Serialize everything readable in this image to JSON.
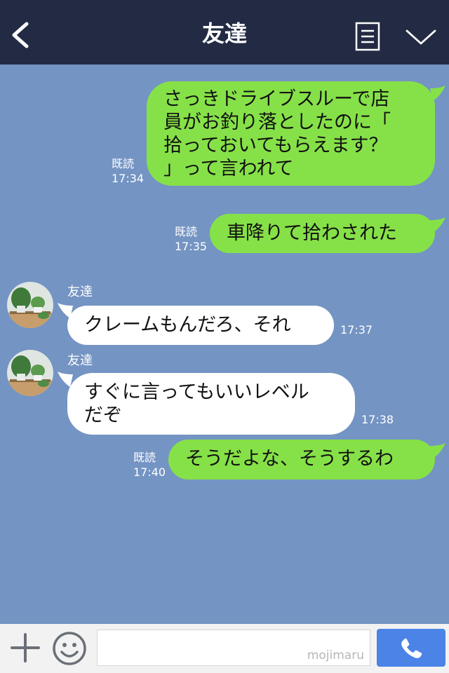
{
  "header": {
    "title": "友達"
  },
  "messages": [
    {
      "side": "out",
      "lines": [
        "さっきドライブスルーで店",
        "員がお釣り落としたのに「",
        "拾っておいてもらえます？",
        "」って言われて"
      ],
      "read": "既読",
      "time": "17:34"
    },
    {
      "side": "out",
      "lines": [
        "車降りて拾わされた"
      ],
      "read": "既読",
      "time": "17:35"
    },
    {
      "side": "in",
      "sender": "友達",
      "lines": [
        "クレームもんだろ、それ"
      ],
      "time": "17:37"
    },
    {
      "side": "in",
      "sender": "友達",
      "lines": [
        "すぐに言ってもいいレベル",
        "だぞ"
      ],
      "time": "17:38"
    },
    {
      "side": "out",
      "lines": [
        "そうだよな、そうするわ"
      ],
      "read": "既読",
      "time": "17:40"
    }
  ],
  "composer": {
    "watermark": "mojimaru"
  },
  "icons": [
    "back-arrow-icon",
    "memo-icon",
    "chevron-down-icon",
    "plus-icon",
    "smiley-icon",
    "phone-icon"
  ],
  "colors": {
    "header": "#232b44",
    "background": "#7494c3",
    "outgoing": "#86e148",
    "incoming": "#ffffff",
    "call_button": "#4b83e6"
  }
}
